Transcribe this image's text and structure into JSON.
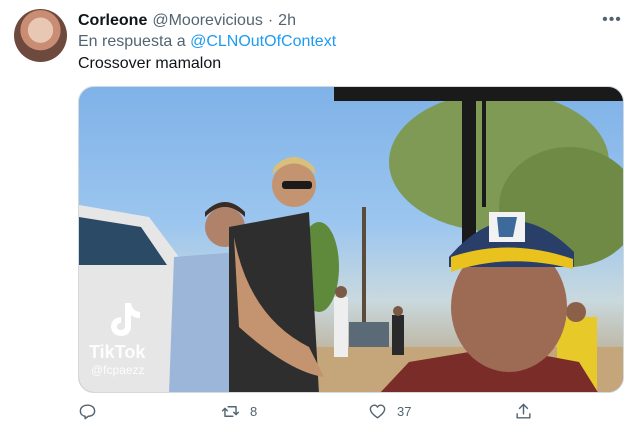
{
  "tweet": {
    "display_name": "Corleone",
    "handle": "@Moorevicious",
    "separator": "·",
    "time": "2h",
    "reply_prefix": "En respuesta a",
    "reply_mention": "@CLNOutOfContext",
    "text": "Crossover mamalon"
  },
  "media": {
    "watermark_brand": "TikTok",
    "watermark_user": "@fcpaezz"
  },
  "actions": {
    "reply_count": "",
    "retweet_count": "8",
    "like_count": "37"
  },
  "icons": [
    "more-icon",
    "reply-icon",
    "retweet-icon",
    "like-icon",
    "share-icon",
    "tiktok-icon"
  ],
  "colors": {
    "link": "#1d9bf0",
    "secondary_text": "#536471",
    "primary_text": "#0f1419"
  }
}
